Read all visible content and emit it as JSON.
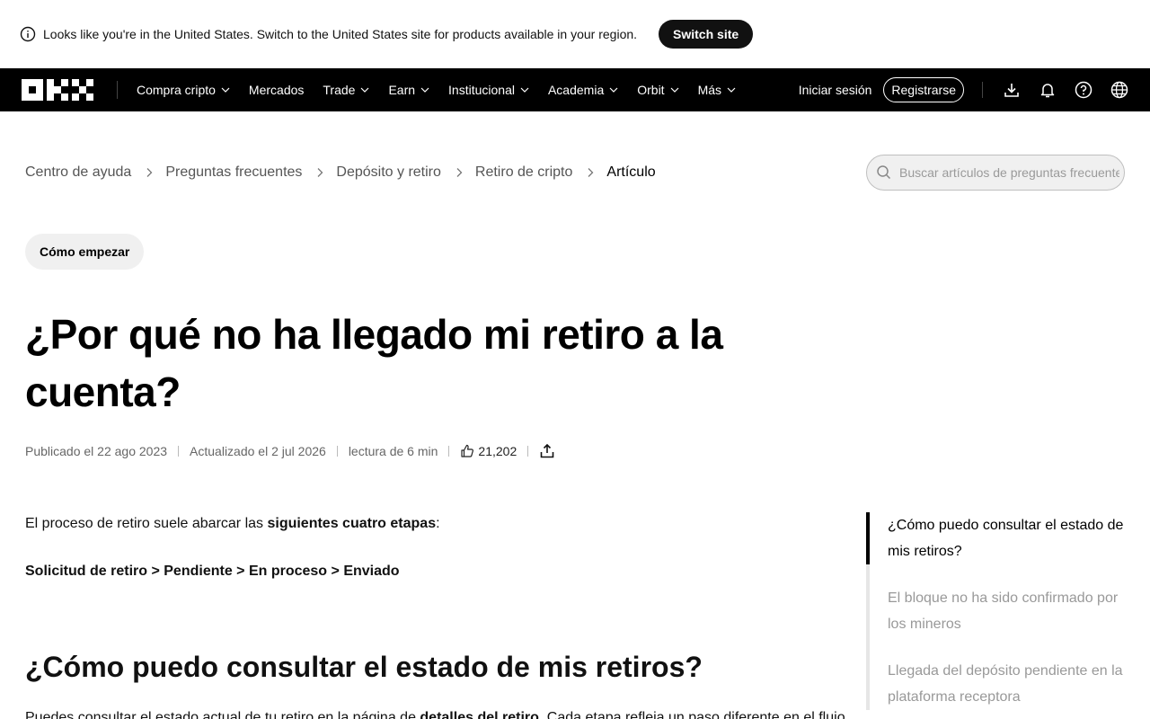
{
  "banner": {
    "message": "Looks like you're in the United States. Switch to the United States site for products available in your region.",
    "switch_label": "Switch site"
  },
  "nav": {
    "items": [
      {
        "label": "Compra cripto",
        "has_dropdown": true
      },
      {
        "label": "Mercados",
        "has_dropdown": false
      },
      {
        "label": "Trade",
        "has_dropdown": true
      },
      {
        "label": "Earn",
        "has_dropdown": true
      },
      {
        "label": "Institucional",
        "has_dropdown": true
      },
      {
        "label": "Academia",
        "has_dropdown": true
      },
      {
        "label": "Orbit",
        "has_dropdown": true
      },
      {
        "label": "Más",
        "has_dropdown": true
      }
    ],
    "login_label": "Iniciar sesión",
    "register_label": "Registrarse",
    "icons": [
      "download-icon",
      "bell-icon",
      "help-icon",
      "globe-icon"
    ]
  },
  "breadcrumb": [
    "Centro de ayuda",
    "Preguntas frecuentes",
    "Depósito y retiro",
    "Retiro de cripto",
    "Artículo"
  ],
  "search": {
    "placeholder": "Buscar artículos de preguntas frecuentes"
  },
  "article": {
    "category": "Cómo empezar",
    "title": "¿Por qué no ha llegado mi retiro a la cuenta?",
    "published": "Publicado el 22 ago 2023",
    "updated": "Actualizado el 2 jul 2026",
    "read_time": "lectura de 6 min",
    "likes": "21,202",
    "intro_prefix": "El proceso de retiro suele abarcar las ",
    "intro_bold": "siguientes cuatro etapas",
    "intro_suffix": ":",
    "stages": "Solicitud de retiro > Pendiente > En proceso > Enviado",
    "section_heading": "¿Cómo puedo consultar el estado de mis retiros?",
    "section_prefix": "Puedes consultar el estado actual de tu retiro en la página de ",
    "section_bold": "detalles del retiro",
    "section_suffix": ". Cada etapa refleja un paso diferente en el flujo"
  },
  "toc": [
    {
      "label": "¿Cómo puedo consultar el estado de mis retiros?",
      "active": true
    },
    {
      "label": "El bloque no ha sido confirmado por los mineros",
      "active": false
    },
    {
      "label": "Llegada del depósito pendiente en la plataforma receptora",
      "active": false
    }
  ],
  "colors": {
    "nav_background": "#000000",
    "switch_button": "#111111",
    "tag_background": "#f0f0f0",
    "muted_text": "#999999"
  }
}
